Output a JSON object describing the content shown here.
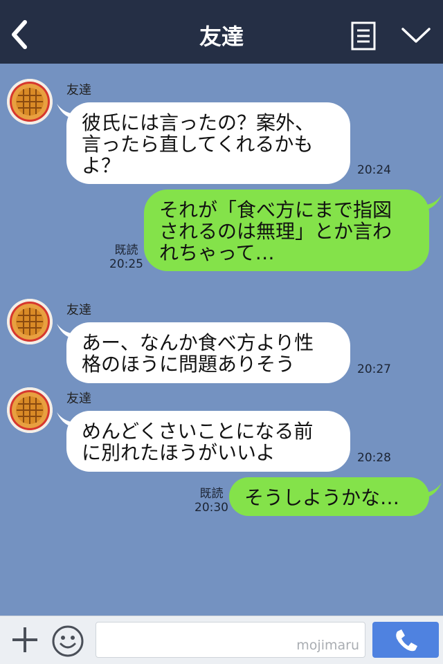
{
  "header": {
    "title": "友達"
  },
  "messages": [
    {
      "side": "in",
      "sender": "友達",
      "text": "彼氏には言ったの？案外、\n言ったら直してくれるかも\nよ？",
      "time": "20:24"
    },
    {
      "side": "out",
      "text": "それが「食べ方にまで指図\nされるのは無理」とか言わ\nれちゃって…",
      "read": "既読",
      "time": "20:25"
    },
    {
      "side": "in",
      "sender": "友達",
      "text": "あー、なんか食べ方より性\n格のほうに問題ありそう",
      "time": "20:27"
    },
    {
      "side": "in",
      "sender": "友達",
      "text": "めんどくさいことになる前\nに別れたほうがいいよ",
      "time": "20:28"
    },
    {
      "side": "out",
      "text": "そうしようかな…",
      "read": "既読",
      "time": "20:30"
    }
  ],
  "footer": {
    "watermark": "mojimaru"
  },
  "colors": {
    "background": "#7492c1",
    "header": "#252f45",
    "incoming_bubble": "#ffffff",
    "outgoing_bubble": "#84e24a",
    "call_button": "#4f82e0"
  },
  "icons": {
    "back": "back-chevron-icon",
    "menu": "notes-menu-icon",
    "collapse": "chevron-down-icon",
    "plus": "plus-icon",
    "emoji": "smile-icon",
    "call": "phone-icon",
    "avatar": "pie-avatar"
  }
}
